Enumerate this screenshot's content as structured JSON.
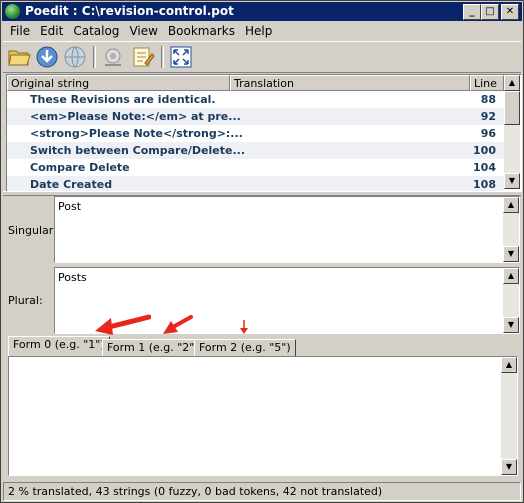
{
  "window": {
    "title": "Poedit : C:\\revision-control.pot",
    "controls": [
      "_",
      "□",
      "✕"
    ]
  },
  "menu": [
    "File",
    "Edit",
    "Catalog",
    "View",
    "Bookmarks",
    "Help"
  ],
  "toolbar": {
    "icons": [
      "open-folder-icon",
      "save-download-icon",
      "globe-icon",
      "update-catalog-icon",
      "edit-comment-icon",
      "fullscreen-icon"
    ]
  },
  "list": {
    "columns": [
      "Original string",
      "Translation",
      "Line"
    ],
    "rows": [
      {
        "original": "These Revisions are identical.",
        "translation": "",
        "line": "88"
      },
      {
        "original": "<em>Please Note:</em> at pre...",
        "translation": "",
        "line": "92"
      },
      {
        "original": "<strong>Please Note</strong>:...",
        "translation": "",
        "line": "96"
      },
      {
        "original": "Switch between Compare/Delete...",
        "translation": "",
        "line": "100"
      },
      {
        "original": "Compare Delete",
        "translation": "",
        "line": "104"
      },
      {
        "original": "Date Created",
        "translation": "",
        "line": "108"
      }
    ]
  },
  "singular": {
    "label": "Singular:",
    "value": "Post"
  },
  "plural": {
    "label": "Plural:",
    "value": "Posts"
  },
  "tabs": [
    "Form 0 (e.g. \"1\")",
    "Form 1 (e.g. \"2\")",
    "Form 2 (e.g. \"5\")"
  ],
  "status": "2 % translated, 43 strings (0 fuzzy, 0 bad tokens, 42 not translated)",
  "colors": {
    "titlebar": "#0a246a",
    "row_text": "#1a3a5c",
    "arrow": "#e8261c"
  }
}
